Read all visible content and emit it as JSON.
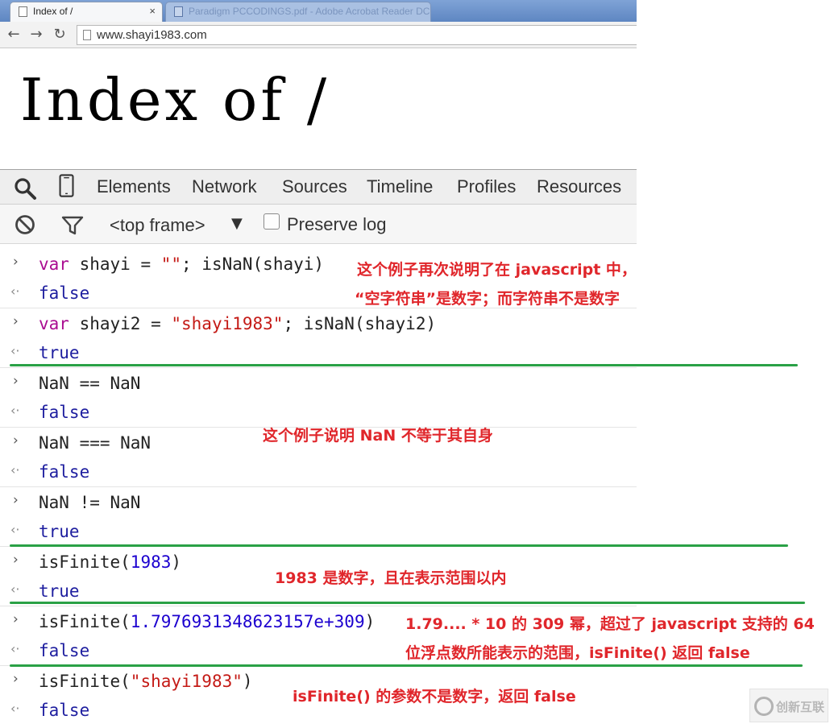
{
  "browser": {
    "tabs": [
      {
        "title": "Index of /",
        "close": "×"
      },
      {
        "title": "Paradigm PCCODINGS.pdf - Adobe Acrobat Reader DC"
      }
    ],
    "nav": {
      "back": "←",
      "forward": "→",
      "reload": "↻"
    },
    "url": "www.shayi1983.com"
  },
  "page": {
    "heading": "Index of /"
  },
  "devtools": {
    "tabs": [
      "Elements",
      "Network",
      "Sources",
      "Timeline",
      "Profiles",
      "Resources"
    ],
    "filter": {
      "frame": "<top frame>",
      "arrow": "▼",
      "preserve_log": "Preserve log"
    },
    "console": {
      "prompt_glyph": "›",
      "result_glyph": "‹·",
      "entries": [
        {
          "input": {
            "kw": "var",
            "a": " shayi = ",
            "s": "\"\"",
            "b": "; isNaN(shayi)"
          },
          "output": "false"
        },
        {
          "input": {
            "kw": "var",
            "a": " shayi2 = ",
            "s": "\"shayi1983\"",
            "b": "; isNaN(shayi2)"
          },
          "output": "true"
        },
        {
          "input": "NaN == NaN",
          "output": "false"
        },
        {
          "input": "NaN === NaN",
          "output": "false"
        },
        {
          "input": "NaN != NaN",
          "output": "true"
        },
        {
          "input": {
            "a": "isFinite(",
            "n": "1983",
            "b": ")"
          },
          "output": "true"
        },
        {
          "input": {
            "a": "isFinite(",
            "n": "1.7976931348623157e+309",
            "b": ")"
          },
          "output": "false"
        },
        {
          "input": {
            "a": "isFinite(",
            "s": "\"shayi1983\"",
            "b": ")"
          },
          "output": "false"
        }
      ]
    }
  },
  "annotations": {
    "note1_line1": "这个例子再次说明了在 javascript 中，",
    "note1_line2": "“空字符串”是数字；而字符串不是数字",
    "note2": "这个例子说明 NaN 不等于其自身",
    "note3": "1983 是数字，且在表示范围以内",
    "note4_line1": "1.79.... * 10 的 309 幂，超过了 javascript 支持的 64",
    "note4_line2": "位浮点数所能表示的范围，isFinite() 返回 false",
    "note5": "isFinite() 的参数不是数字，返回 false"
  },
  "watermark": {
    "text": "创新互联"
  },
  "colors": {
    "annotation": "#e0262b",
    "underline": "#2aa146",
    "keyword": "#aa0d91",
    "string": "#c41a16",
    "number": "#1c00cf",
    "result": "#1e1e9f"
  }
}
